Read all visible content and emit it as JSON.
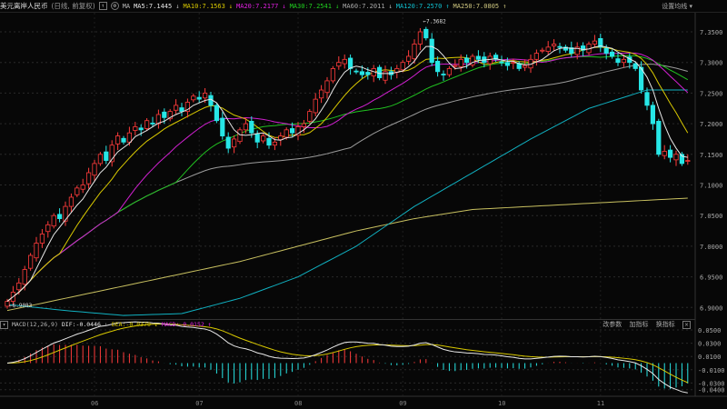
{
  "header": {
    "title": "美元离岸人民币",
    "mode": "(日线, 前复权)",
    "ma_label": "MA",
    "ma5": "MA5:7.1445",
    "ma10": "MA10:7.1563",
    "ma20": "MA20:7.2177",
    "ma30": "MA30:7.2541",
    "ma60": "MA60:7.2011",
    "ma120": "MA120:7.2570",
    "ma250": "MA250:7.0805",
    "set_ma": "设置均线 ▾"
  },
  "macd_header": {
    "name": "MACD(12,26,9)",
    "dif": "DIF:-0.0446",
    "dea": "DEA:-0.0370",
    "macd": "MACD:-0.0152",
    "buttons": [
      "改参数",
      "加指标",
      "换指标"
    ]
  },
  "colors": {
    "up": "#ff3b3b",
    "down": "#27e6e6",
    "ma5": "#e8e8e8",
    "ma10": "#d8c800",
    "ma20": "#d020d0",
    "ma30": "#20c020",
    "ma60": "#9a9a9a",
    "ma120": "#10b0c0",
    "ma250": "#c8c060"
  },
  "chart_data": {
    "type": "candlestick",
    "price_axis": {
      "ticks": [
        "7.3500",
        "7.3000",
        "7.2500",
        "7.2000",
        "7.1500",
        "7.1000",
        "7.0500",
        "7.0000",
        "6.9500",
        "6.9000"
      ],
      "range": [
        6.88,
        7.375
      ]
    },
    "macd_axis": {
      "ticks": [
        "0.0500",
        "0.0300",
        "0.0100",
        "-0.0100",
        "-0.0300",
        "-0.0400"
      ],
      "range": [
        -0.044,
        0.052
      ]
    },
    "x_labels": [
      {
        "label": "06",
        "index": 15
      },
      {
        "label": "07",
        "index": 33
      },
      {
        "label": "08",
        "index": 50
      },
      {
        "label": "09",
        "index": 68
      },
      {
        "label": "10",
        "index": 85
      },
      {
        "label": "11",
        "index": 102
      }
    ],
    "high_label": "7.3682",
    "low_label": "6.9083",
    "closes": [
      6.91,
      6.925,
      6.94,
      6.962,
      6.985,
      7.005,
      7.02,
      7.035,
      7.05,
      7.045,
      7.065,
      7.08,
      7.095,
      7.1,
      7.12,
      7.135,
      7.15,
      7.14,
      7.165,
      7.18,
      7.17,
      7.185,
      7.195,
      7.19,
      7.205,
      7.2,
      7.215,
      7.21,
      7.22,
      7.23,
      7.22,
      7.235,
      7.245,
      7.24,
      7.25,
      7.23,
      7.205,
      7.18,
      7.16,
      7.175,
      7.19,
      7.2,
      7.185,
      7.17,
      7.18,
      7.165,
      7.17,
      7.18,
      7.19,
      7.185,
      7.195,
      7.2,
      7.22,
      7.24,
      7.255,
      7.27,
      7.29,
      7.3,
      7.305,
      7.29,
      7.285,
      7.28,
      7.28,
      7.29,
      7.275,
      7.285,
      7.28,
      7.29,
      7.3,
      7.31,
      7.33,
      7.35,
      7.34,
      7.3,
      7.285,
      7.28,
      7.29,
      7.295,
      7.305,
      7.3,
      7.31,
      7.305,
      7.3,
      7.31,
      7.305,
      7.3,
      7.295,
      7.3,
      7.29,
      7.295,
      7.305,
      7.315,
      7.32,
      7.325,
      7.33,
      7.325,
      7.32,
      7.315,
      7.325,
      7.32,
      7.33,
      7.335,
      7.325,
      7.315,
      7.31,
      7.3,
      7.305,
      7.3,
      7.29,
      7.255,
      7.23,
      7.2,
      7.15,
      7.155,
      7.145,
      7.15,
      7.135,
      7.14
    ],
    "ma120_samples": {
      "step": 10,
      "values": [
        6.905,
        6.895,
        6.887,
        6.89,
        6.915,
        6.95,
        7.0,
        7.065,
        7.12,
        7.175,
        7.225,
        7.255,
        7.255
      ]
    },
    "ma250_samples": {
      "step": 10,
      "values": [
        6.895,
        6.915,
        6.935,
        6.955,
        6.975,
        7.0,
        7.025,
        7.045,
        7.06,
        7.065,
        7.07,
        7.075,
        7.08
      ]
    }
  }
}
